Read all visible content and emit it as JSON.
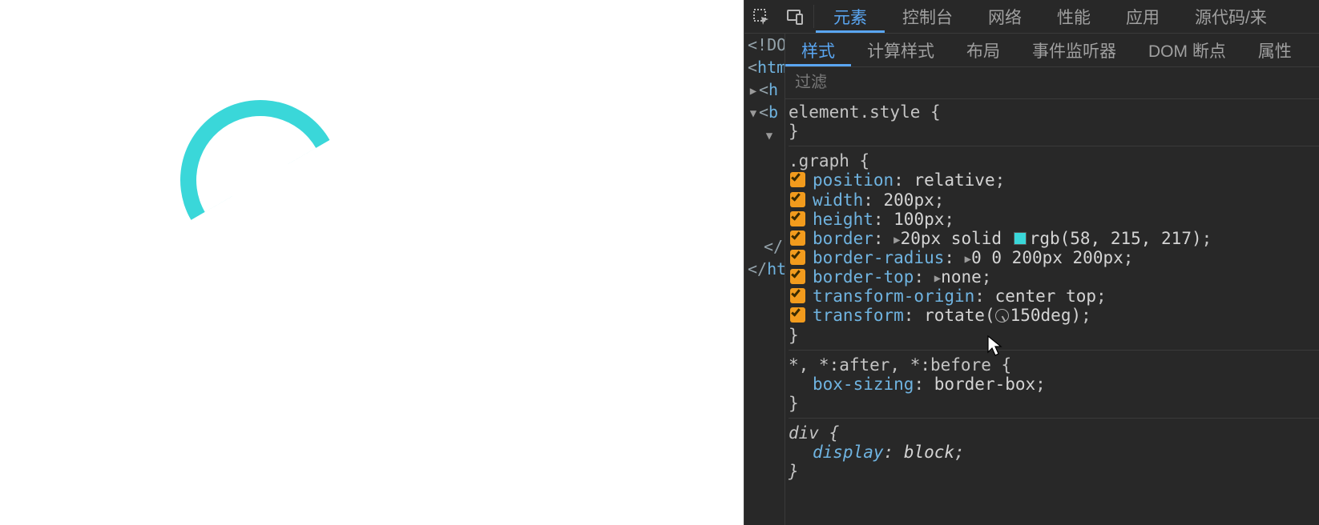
{
  "main_tabs": {
    "elements": "元素",
    "console": "控制台",
    "network": "网络",
    "performance": "性能",
    "application": "应用",
    "sources": "源代码/来"
  },
  "sub_tabs": {
    "styles": "样式",
    "computed": "计算样式",
    "layout": "布局",
    "listeners": "事件监听器",
    "dom_bp": "DOM 断点",
    "properties": "属性"
  },
  "filter_placeholder": "过滤",
  "dom": {
    "doctype": "<!DO",
    "html_open": "<htm",
    "head": "<h",
    "body": "<b",
    "close_unknown": "</",
    "html_close": "</ht"
  },
  "rules": {
    "element_style": {
      "selector": "element.style",
      "open": "{",
      "close": "}"
    },
    "graph": {
      "selector": ".graph",
      "open": "{",
      "close": "}",
      "decls": [
        {
          "prop": "position",
          "val": "relative",
          "punc": ";"
        },
        {
          "prop": "width",
          "val": "200px",
          "punc": ";"
        },
        {
          "prop": "height",
          "val": "100px",
          "punc": ";"
        },
        {
          "prop": "border",
          "expand": true,
          "swatch": "#3ad7d9",
          "val_pre": "20px solid ",
          "val_post": "rgb(58, 215, 217)",
          "punc": ";"
        },
        {
          "prop": "border-radius",
          "expand": true,
          "val": "0 0 200px 200px",
          "punc": ";"
        },
        {
          "prop": "border-top",
          "expand": true,
          "val": "none",
          "punc": ";"
        },
        {
          "prop": "transform-origin",
          "val": "center top",
          "punc": ";"
        },
        {
          "prop": "transform",
          "rotate": true,
          "val_pre": "rotate(",
          "val_deg": "150deg",
          "val_post": ")",
          "punc": ";"
        }
      ]
    },
    "universal": {
      "selector": "*, *:after, *:before",
      "open": "{",
      "close": "}",
      "decl": {
        "prop": "box-sizing",
        "val": "border-box",
        "punc": ";"
      }
    },
    "div": {
      "selector": "div",
      "open": "{",
      "close": "}",
      "decl": {
        "prop": "display",
        "val": "block",
        "punc": ";"
      }
    }
  }
}
